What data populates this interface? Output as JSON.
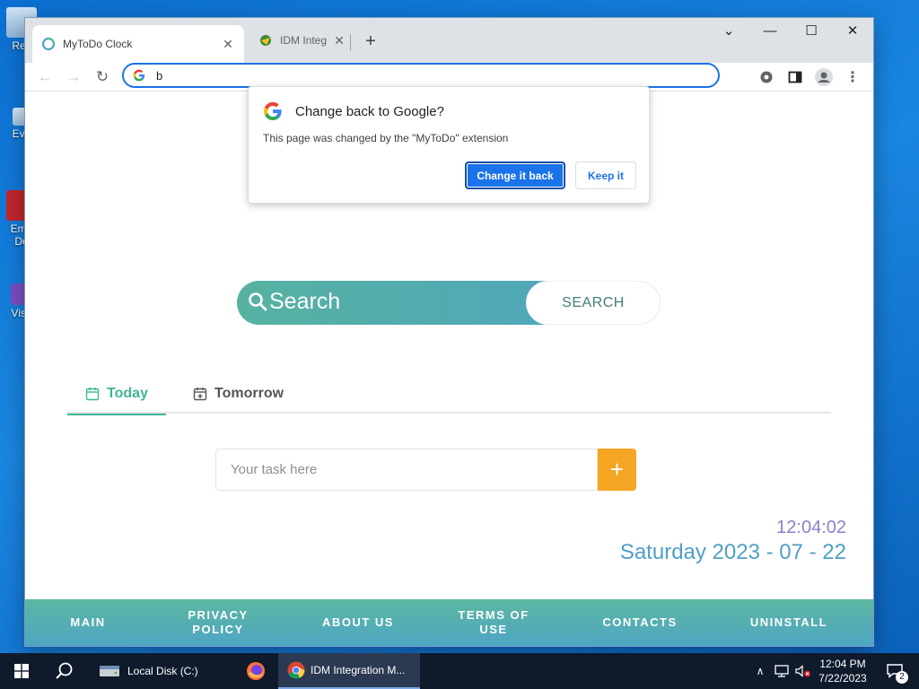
{
  "desktop": {
    "icons": [
      {
        "label": "Rec"
      },
      {
        "label": "Eve"
      },
      {
        "label": "Emb"
      },
      {
        "label": "De"
      },
      {
        "label": "Visu"
      }
    ]
  },
  "browser": {
    "tabs": [
      {
        "title": "MyToDo Clock",
        "active": true
      },
      {
        "title": "IDM Integ",
        "active": false
      }
    ],
    "new_tab": "+",
    "window_controls": {
      "menu": "⌄",
      "minimize": "—",
      "maximize": "☐",
      "close": "✕"
    },
    "address": "b"
  },
  "popup": {
    "title": "Change back to Google?",
    "message": "This page was changed by the \"MyToDo\" extension",
    "primary_button": "Change it back",
    "secondary_button": "Keep it"
  },
  "page": {
    "search": {
      "label": "Search",
      "button": "SEARCH"
    },
    "tabs": [
      {
        "label": "Today",
        "active": true
      },
      {
        "label": "Tomorrow",
        "active": false
      }
    ],
    "task_input": {
      "placeholder": "Your task here",
      "value": ""
    },
    "add_button": "+",
    "time": "12:04:02",
    "date": "Saturday 2023 - 07 - 22",
    "footer": [
      "MAIN",
      "PRIVACY POLICY",
      "ABOUT US",
      "TERMS OF USE",
      "CONTACTS",
      "UNINSTALL"
    ]
  },
  "taskbar": {
    "items": [
      {
        "label": "Local Disk (C:)"
      },
      {
        "label": "IDM Integration M..."
      }
    ],
    "clock": {
      "time": "12:04 PM",
      "date": "7/22/2023"
    },
    "notifications": "2"
  },
  "colors": {
    "accent": "#1a73e8",
    "brand_green": "#3fb596",
    "add_orange": "#f5a623",
    "clock_purple": "#8b7fc9",
    "date_blue": "#4f9fc6"
  }
}
